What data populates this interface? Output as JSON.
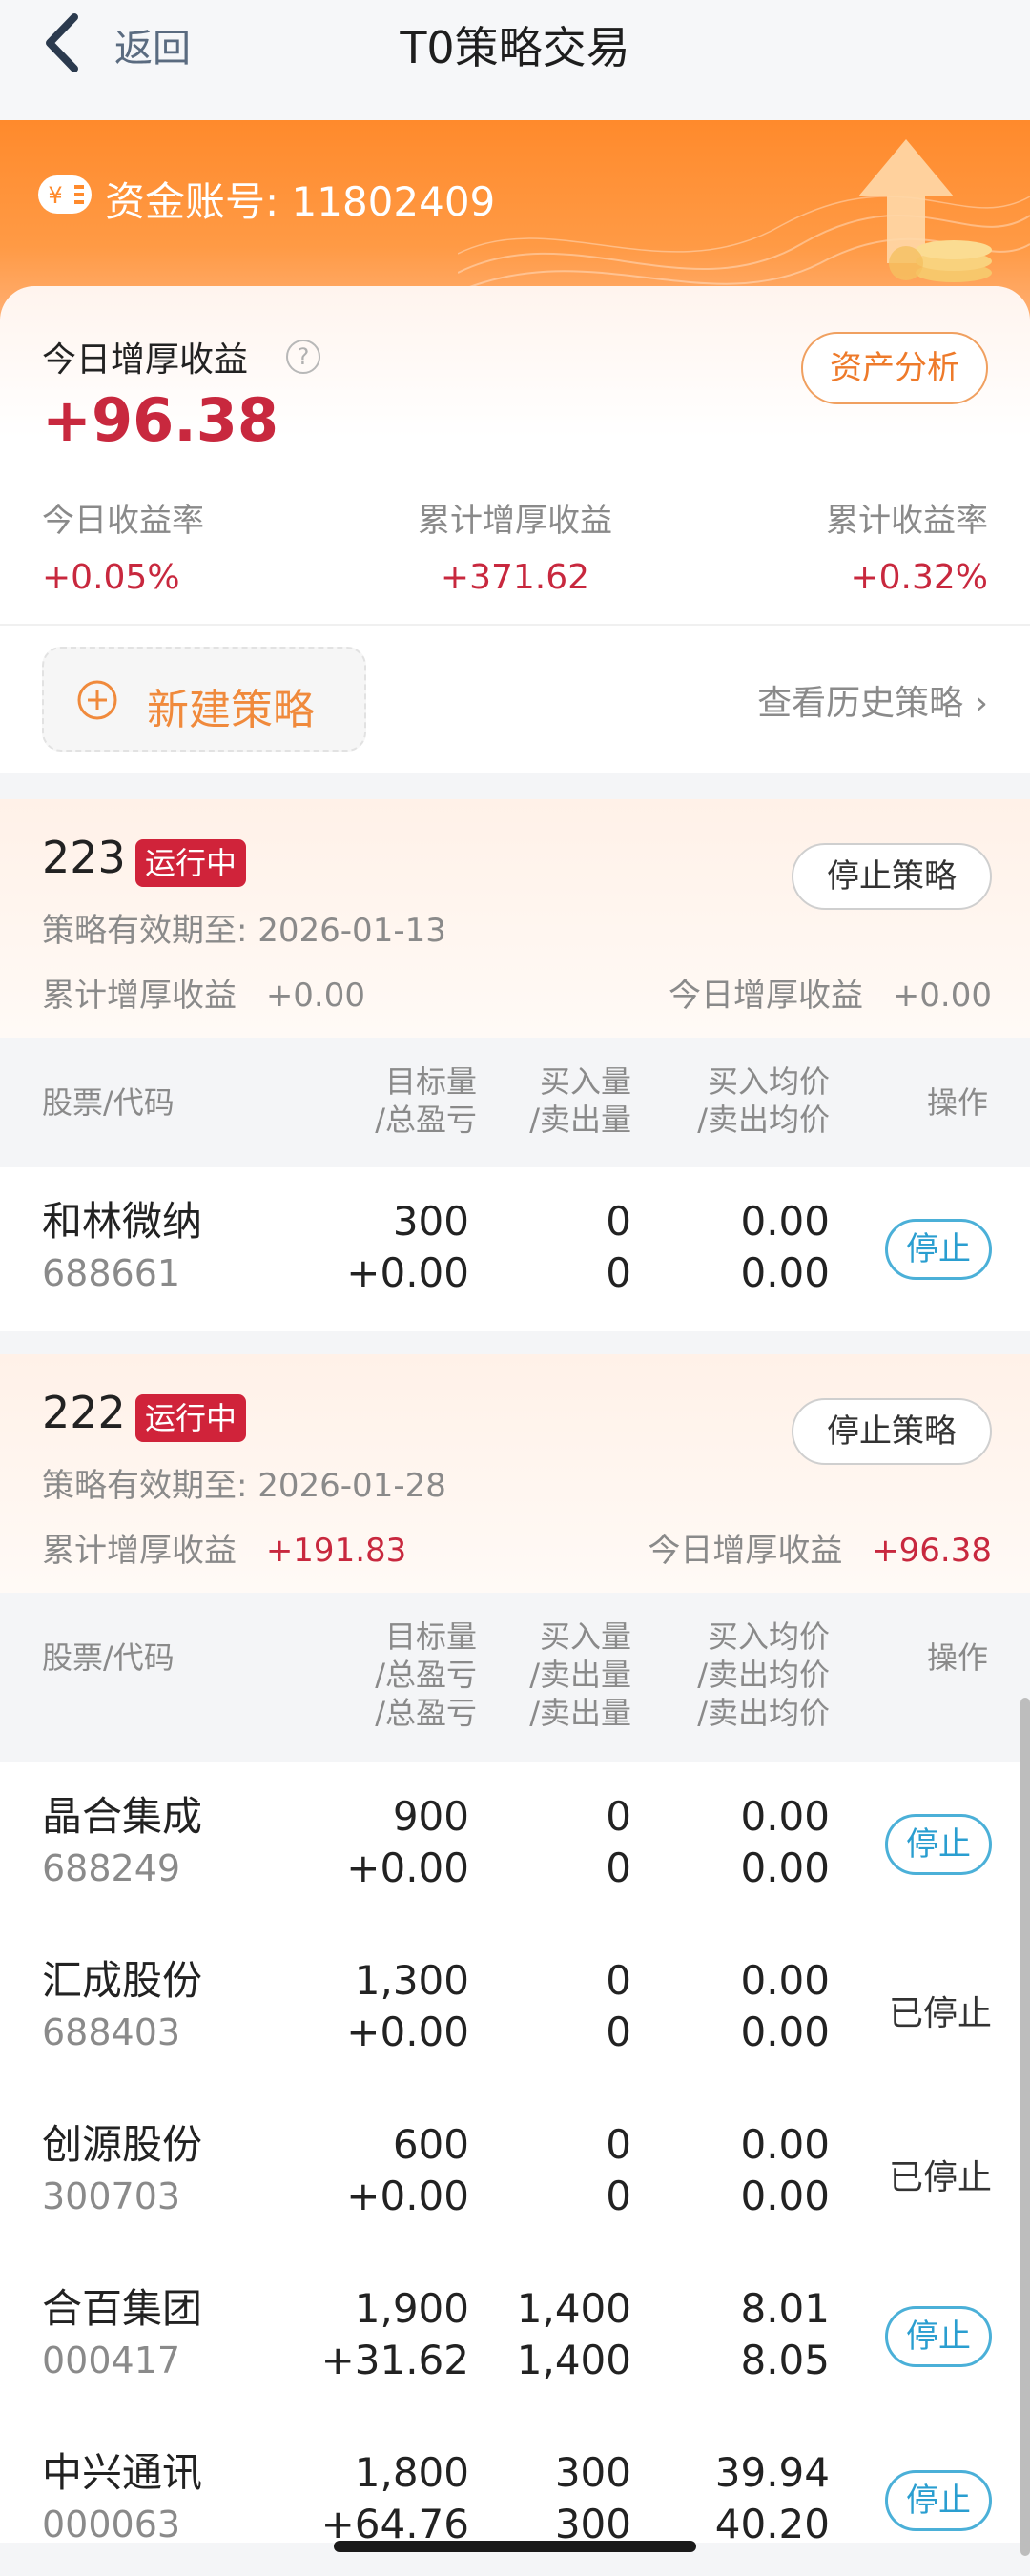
{
  "nav": {
    "back_label": "返回",
    "title": "T0策略交易"
  },
  "header": {
    "account": "资金账号: 11802409"
  },
  "summary": {
    "today_label": "今日增厚收益",
    "today_value": "+96.38",
    "analysis_button": "资产分析",
    "stats": [
      {
        "label": "今日收益率",
        "value": "+0.05%"
      },
      {
        "label": "累计增厚收益",
        "value": "+371.62"
      },
      {
        "label": "累计收益率",
        "value": "+0.32%"
      }
    ]
  },
  "actions": {
    "new_strategy": "新建策略",
    "history": "查看历史策略 ›"
  },
  "columns": {
    "name": "股票/代码",
    "target_1": "目标量",
    "target_2": "/总盈亏",
    "buy_1": "买入量",
    "buy_2": "/卖出量",
    "price_1": "买入均价",
    "price_2": "/卖出均价",
    "op": "操作"
  },
  "strategies": [
    {
      "id": "223",
      "status": "运行中",
      "stop_label": "停止策略",
      "expiry": "策略有效期至:  2026-01-13",
      "cum_label": "累计增厚收益",
      "cum_value": "+0.00",
      "today_label": "今日增厚收益",
      "today_value": "+0.00",
      "rows": [
        {
          "name": "和林微纳",
          "code": "688661",
          "target": "300",
          "pnl": "+0.00",
          "buy": "0",
          "sell": "0",
          "buy_price": "0.00",
          "sell_price": "0.00",
          "op": "停止"
        }
      ]
    },
    {
      "id": "222",
      "status": "运行中",
      "stop_label": "停止策略",
      "expiry": "策略有效期至:  2026-01-28",
      "cum_label": "累计增厚收益",
      "cum_value": "+191.83",
      "today_label": "今日增厚收益",
      "today_value": "+96.38",
      "rows": [
        {
          "name": "晶合集成",
          "code": "688249",
          "target": "900",
          "pnl": "+0.00",
          "buy": "0",
          "sell": "0",
          "buy_price": "0.00",
          "sell_price": "0.00",
          "op": "停止"
        },
        {
          "name": "汇成股份",
          "code": "688403",
          "target": "1,300",
          "pnl": "+0.00",
          "buy": "0",
          "sell": "0",
          "buy_price": "0.00",
          "sell_price": "0.00",
          "op_text": "已停止"
        },
        {
          "name": "创源股份",
          "code": "300703",
          "target": "600",
          "pnl": "+0.00",
          "buy": "0",
          "sell": "0",
          "buy_price": "0.00",
          "sell_price": "0.00",
          "op_text": "已停止"
        },
        {
          "name": "合百集团",
          "code": "000417",
          "target": "1,900",
          "pnl": "+31.62",
          "buy": "1,400",
          "sell": "1,400",
          "buy_price": "8.01",
          "sell_price": "8.05",
          "op": "停止"
        },
        {
          "name": "中兴通讯",
          "code": "000063",
          "target": "1,800",
          "pnl": "+64.76",
          "buy": "300",
          "sell": "300",
          "buy_price": "39.94",
          "sell_price": "40.20",
          "op": "停止"
        }
      ]
    }
  ]
}
